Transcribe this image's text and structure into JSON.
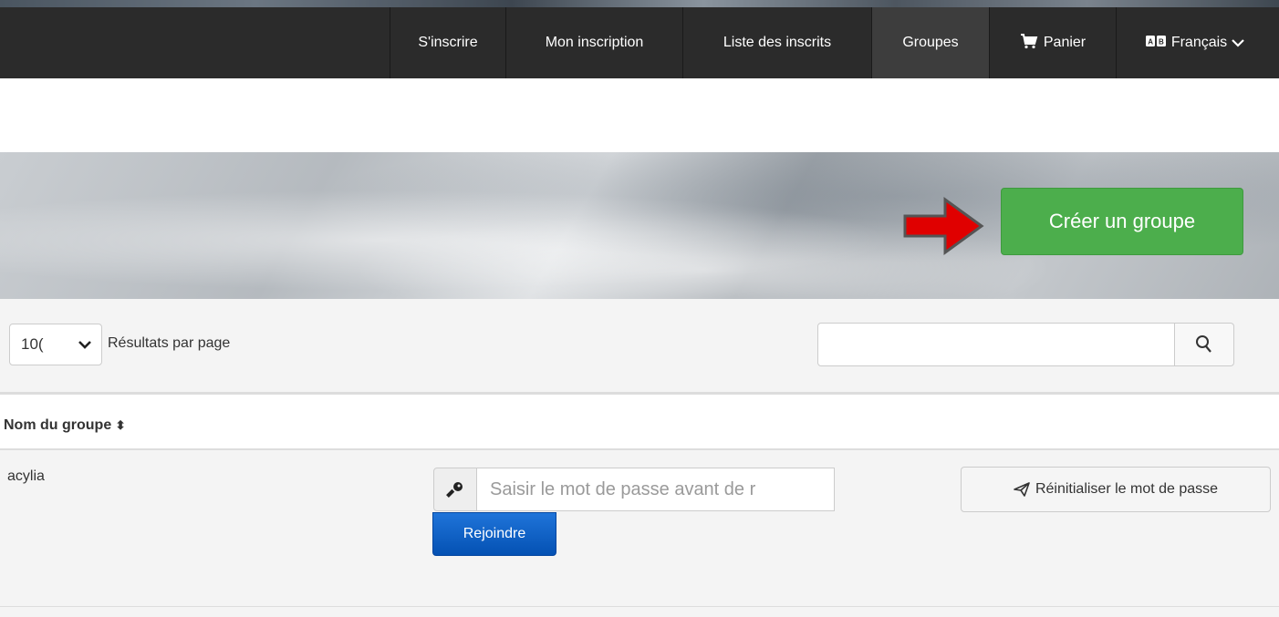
{
  "nav": {
    "items": [
      {
        "label": "S'inscrire"
      },
      {
        "label": "Mon inscription"
      },
      {
        "label": "Liste des inscrits"
      },
      {
        "label": "Groupes"
      },
      {
        "label": "Panier",
        "icon": "cart-icon"
      },
      {
        "label": "Français",
        "icon": "language-icon"
      }
    ]
  },
  "hero": {
    "create_group_label": "Créer un groupe",
    "arrow_color": "#e00000"
  },
  "table_controls": {
    "per_page_value": "10(",
    "per_page_label": "Résultats par page",
    "search_placeholder": ""
  },
  "table": {
    "columns": [
      {
        "label": "Nom du groupe",
        "sort_icon": "sort-icon"
      }
    ],
    "rows": [
      {
        "name": "acylia",
        "password_placeholder": "Saisir le mot de passe avant de r",
        "join_label": "Rejoindre",
        "reset_label": "Réinitialiser le mot de passe"
      }
    ]
  },
  "colors": {
    "navbar": "#2b2b2b",
    "create_button": "#4cae4c",
    "join_button": "#0a5ec8"
  }
}
